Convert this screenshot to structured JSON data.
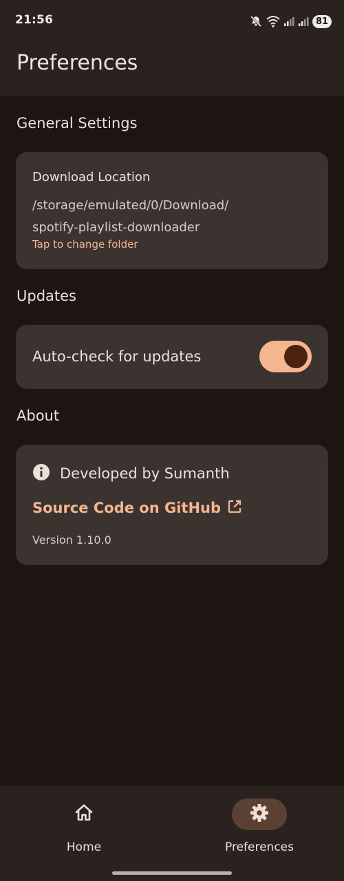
{
  "status_bar": {
    "time": "21:56",
    "battery": "81",
    "icons": [
      "mute-icon",
      "wifi-icon",
      "signal-icon",
      "signal-icon"
    ]
  },
  "header": {
    "title": "Preferences"
  },
  "general": {
    "section_title": "General Settings",
    "download_label": "Download Location",
    "download_path_line1": "/storage/emulated/0/Download/",
    "download_path_line2": "spotify-playlist-downloader",
    "change_hint": "Tap to change folder"
  },
  "updates": {
    "section_title": "Updates",
    "auto_check_label": "Auto-check for updates",
    "auto_check_enabled": true
  },
  "about": {
    "section_title": "About",
    "developer": "Developed by Sumanth",
    "github_link": "Source Code on GitHub",
    "version": "Version 1.10.0"
  },
  "bottom_nav": {
    "items": [
      {
        "label": "Home",
        "icon": "home-icon",
        "selected": false
      },
      {
        "label": "Preferences",
        "icon": "gear-icon",
        "selected": true
      }
    ]
  },
  "colors": {
    "background": "#1c1512",
    "surface": "#2a221e",
    "card": "#3b3330",
    "accent": "#f5b58e",
    "selected_pill": "#5a4134"
  }
}
